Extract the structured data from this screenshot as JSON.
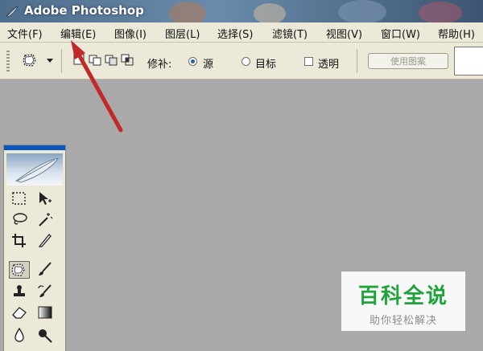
{
  "window": {
    "title": "Adobe Photoshop"
  },
  "menubar": {
    "items": [
      {
        "label": "文件(F)"
      },
      {
        "label": "编辑(E)"
      },
      {
        "label": "图像(I)"
      },
      {
        "label": "图层(L)"
      },
      {
        "label": "选择(S)"
      },
      {
        "label": "滤镜(T)"
      },
      {
        "label": "视图(V)"
      },
      {
        "label": "窗口(W)"
      },
      {
        "label": "帮助(H)"
      }
    ]
  },
  "options": {
    "patch_label": "修补:",
    "source_label": "源",
    "target_label": "目标",
    "transparent_label": "透明",
    "use_pattern_label": "使用图案",
    "selected_mode": "源"
  },
  "watermark": {
    "brand": "百科全说",
    "slogan": "助你轻松解决"
  },
  "colors": {
    "annotation_arrow": "#c0282a",
    "brand_green": "#20a33d",
    "toolbox_header": "#0b57c2"
  },
  "icons": [
    "photoshop-feather-icon",
    "patch-tool-icon",
    "dropdown-arrow-icon",
    "new-selection-icon",
    "add-selection-icon",
    "subtract-selection-icon",
    "intersect-selection-icon",
    "marquee-icon",
    "move-icon",
    "lasso-icon",
    "magic-wand-icon",
    "crop-icon",
    "slice-icon",
    "healing-patch-icon",
    "brush-icon",
    "stamp-icon",
    "history-brush-icon",
    "eraser-icon",
    "gradient-icon",
    "blur-icon",
    "dodge-icon"
  ]
}
